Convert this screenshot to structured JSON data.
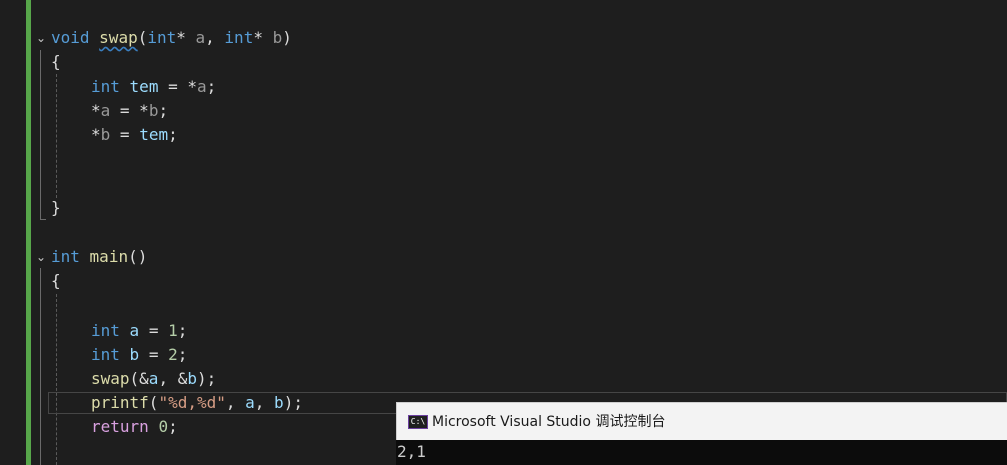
{
  "editor": {
    "swap_signature": {
      "ret": "void",
      "name": "swap",
      "open": "(",
      "t1": "int",
      "star1": "*",
      "p1": " a",
      "comma": ", ",
      "t2": "int",
      "star2": "*",
      "p2": " b",
      "close": ")"
    },
    "swap_body": {
      "open_brace": "{",
      "l1": {
        "type": "int",
        "var": "tem",
        "op": " = *",
        "arg": "a",
        "end": ";"
      },
      "l2": {
        "star": "*",
        "lhs": "a",
        "op": " = *",
        "rhs": "b",
        "end": ";"
      },
      "l3": {
        "star": "*",
        "lhs": "b",
        "op": " = ",
        "rhs": "tem",
        "end": ";"
      },
      "close_brace": "}"
    },
    "main_signature": {
      "ret": "int",
      "name": "main",
      "parens": "()"
    },
    "main_body": {
      "open_brace": "{",
      "l1": {
        "type": "int",
        "var": "a",
        "op": " = ",
        "val": "1",
        "end": ";"
      },
      "l2": {
        "type": "int",
        "var": "b",
        "op": " = ",
        "val": "2",
        "end": ";"
      },
      "l3": {
        "fn": "swap",
        "open": "(&",
        "a1": "a",
        "mid": ", &",
        "a2": "b",
        "end": ");"
      },
      "l4": {
        "fn": "printf",
        "open": "(",
        "fmt": "\"%d,%d\"",
        "mid1": ", ",
        "a1": "a",
        "mid2": ", ",
        "a2": "b",
        "end": ");"
      },
      "l5": {
        "kw": "return",
        "sp": " ",
        "val": "0",
        "end": ";"
      }
    }
  },
  "console": {
    "title": "Microsoft Visual Studio 调试控制台",
    "icon_label": "C:\\",
    "output_line_1": "2,1"
  },
  "colors": {
    "background": "#1e1e1e",
    "keyword": "#569cd6",
    "control_keyword": "#d8a0df",
    "function": "#dcdcaa",
    "variable": "#9cdcfe",
    "parameter": "#9a9a9a",
    "number": "#b5cea8",
    "string": "#d69d85",
    "change_bar": "#57a64a"
  }
}
